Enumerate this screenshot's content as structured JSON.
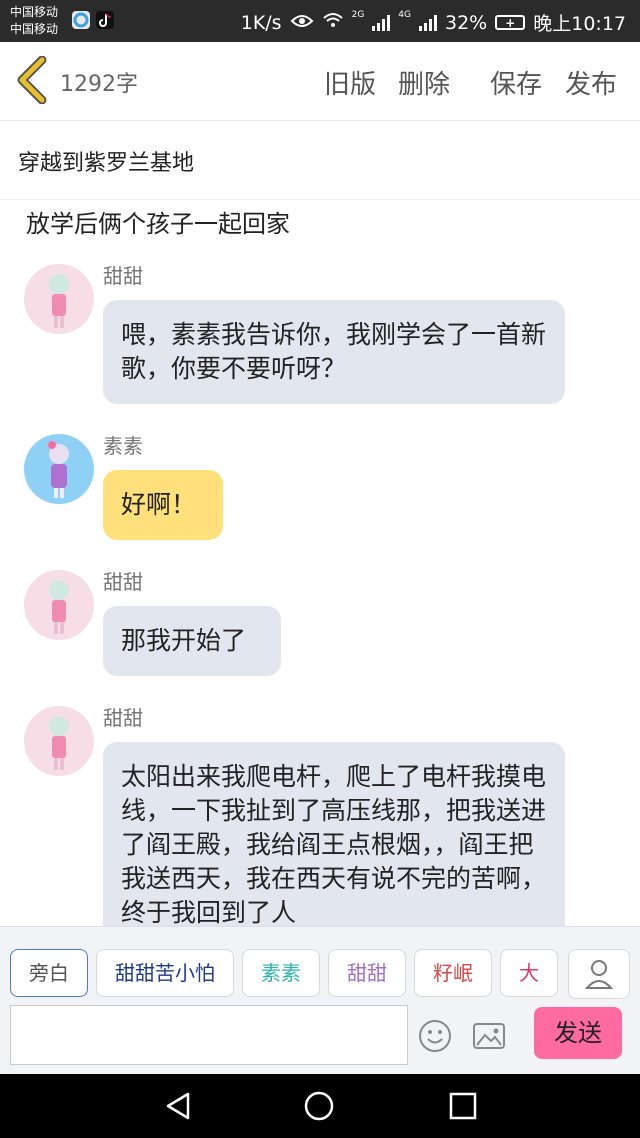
{
  "status_bar": {
    "carrier_1": "中国移动",
    "carrier_2": "中国移动",
    "speed": "1K/s",
    "signal_1": "2G",
    "signal_2": "4G",
    "battery": "32%",
    "time": "晚上10:17"
  },
  "header": {
    "word_count": "1292字",
    "old_version": "旧版",
    "delete": "删除",
    "save": "保存",
    "publish": "发布"
  },
  "story": {
    "title": "穿越到紫罗兰基地",
    "narration": "放学后俩个孩子一起回家"
  },
  "messages": [
    {
      "speaker": "甜甜",
      "text": "喂，素素我告诉你，我刚学会了一首新歌，你要不要听呀？",
      "style": "gray"
    },
    {
      "speaker": "素素",
      "text": "好啊！",
      "style": "yellow"
    },
    {
      "speaker": "甜甜",
      "text": "那我开始了",
      "style": "gray"
    },
    {
      "speaker": "甜甜",
      "text": "太阳出来我爬电杆，爬上了电杆我摸电线，一下我扯到了高压线那，把我送进了阎王殿，我给阎王点根烟，，阎王把我送西天，我在西天有说不完的苦啊，终于我回到了人",
      "style": "gray"
    }
  ],
  "character_chips": [
    {
      "label": "旁白",
      "color": "#555555"
    },
    {
      "label": "甜甜苦小怕",
      "color": "#1f3c8a"
    },
    {
      "label": "素素",
      "color": "#2bb5a8"
    },
    {
      "label": "甜甜",
      "color": "#a070c8"
    },
    {
      "label": "籽岷",
      "color": "#d24a4a"
    },
    {
      "label": "大",
      "color": "#d83a6a"
    }
  ],
  "composer": {
    "input_value": "",
    "send_label": "发送"
  },
  "colors": {
    "send_button": "#ff6aa0",
    "bubble_gray": "#e2e6ef",
    "bubble_yellow": "#ffe07a",
    "back_arrow": "#e8c02a"
  }
}
